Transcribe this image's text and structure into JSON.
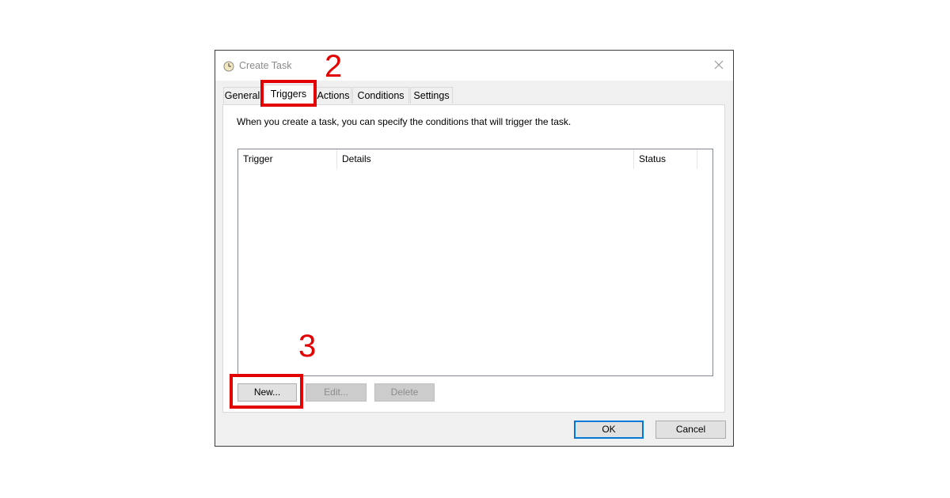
{
  "window": {
    "title": "Create Task",
    "icon": "task-scheduler-clock-icon"
  },
  "tabs": [
    {
      "label": "General",
      "active": false
    },
    {
      "label": "Triggers",
      "active": true
    },
    {
      "label": "Actions",
      "active": false
    },
    {
      "label": "Conditions",
      "active": false
    },
    {
      "label": "Settings",
      "active": false
    }
  ],
  "triggers_panel": {
    "description": "When you create a task, you can specify the conditions that will trigger the task.",
    "columns": [
      "Trigger",
      "Details",
      "Status"
    ],
    "rows": [],
    "buttons": {
      "new": "New...",
      "edit": "Edit...",
      "delete": "Delete"
    }
  },
  "footer": {
    "ok": "OK",
    "cancel": "Cancel"
  },
  "annotations": {
    "step_tab": "2",
    "step_button": "3",
    "highlight_color": "#e30000"
  }
}
